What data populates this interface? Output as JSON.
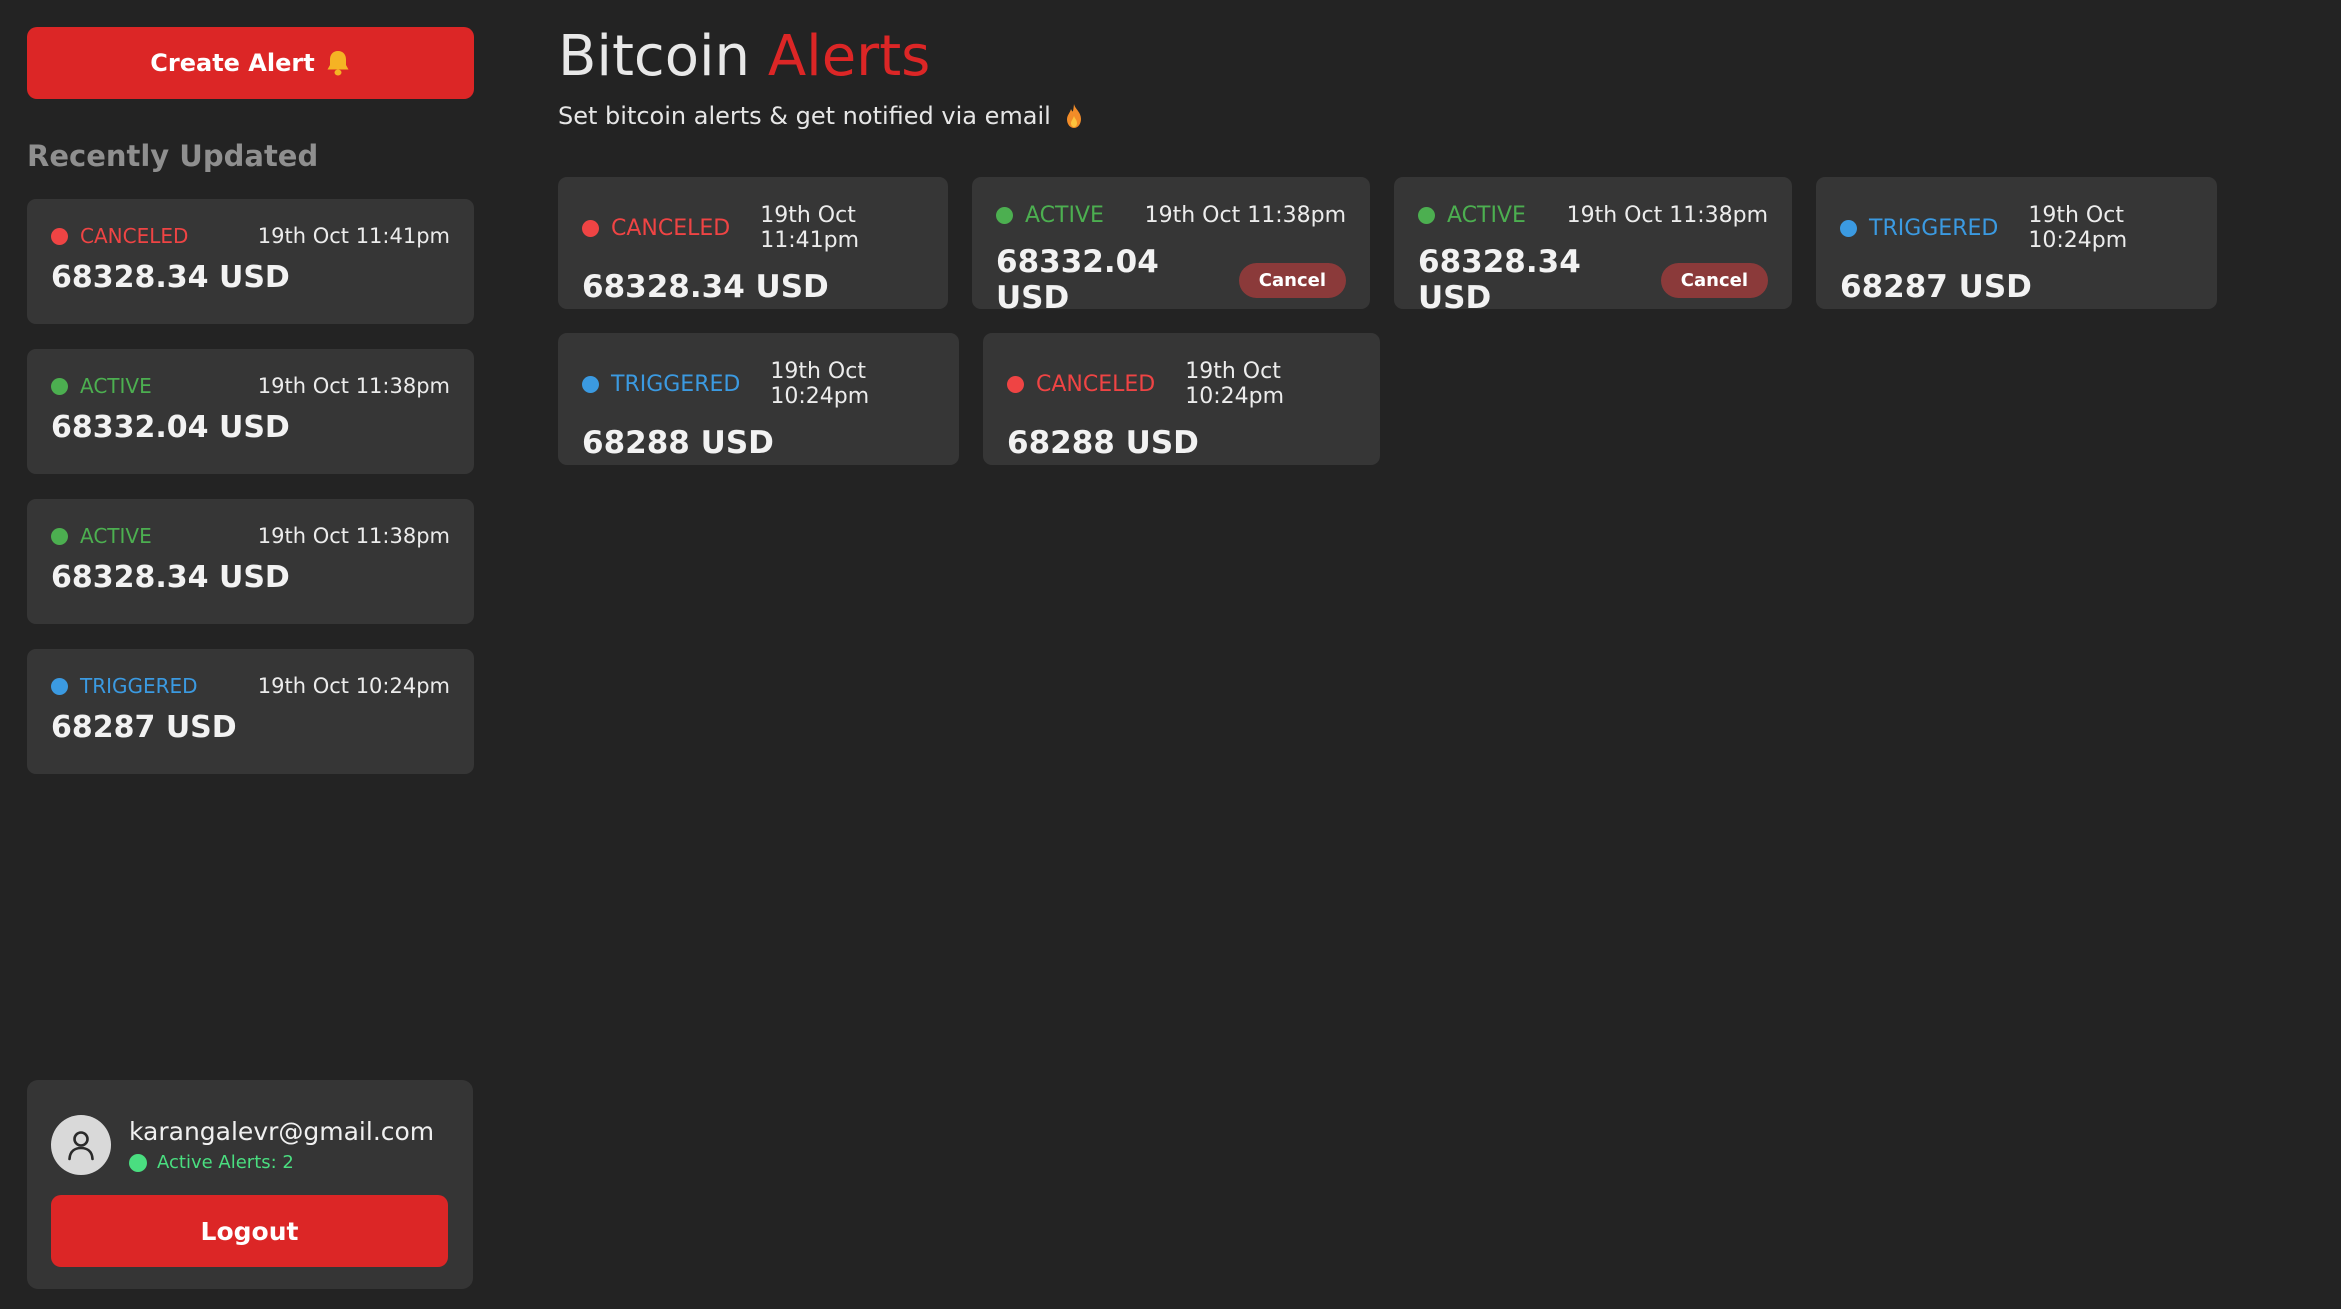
{
  "colors": {
    "background": "#232323",
    "card": "#363636",
    "accent": "#dc2626",
    "canceled": "#ef4444",
    "active": "#4caf50",
    "triggered": "#3b9ae1"
  },
  "sidebar": {
    "create_label": "Create Alert",
    "create_icon": "bell-icon",
    "recent_heading": "Recently Updated",
    "recent": [
      {
        "status": "CANCELED",
        "time": "19th Oct 11:41pm",
        "amount": "68328.34 USD"
      },
      {
        "status": "ACTIVE",
        "time": "19th Oct 11:38pm",
        "amount": "68332.04 USD"
      },
      {
        "status": "ACTIVE",
        "time": "19th Oct 11:38pm",
        "amount": "68328.34 USD"
      },
      {
        "status": "TRIGGERED",
        "time": "19th Oct 10:24pm",
        "amount": "68287 USD"
      }
    ],
    "user": {
      "avatar_icon": "user-icon",
      "email": "karangalevr@gmail.com",
      "active_alerts": "Active Alerts: 2",
      "logout_label": "Logout"
    }
  },
  "main": {
    "title_plain": "Bitcoin",
    "title_accent": "Alerts",
    "subtitle": "Set bitcoin alerts & get notified via email",
    "subtitle_icon": "flame-icon",
    "cancel_label": "Cancel",
    "alerts": [
      {
        "status": "CANCELED",
        "time": "19th Oct 11:41pm",
        "amount": "68328.34 USD"
      },
      {
        "status": "ACTIVE",
        "time": "19th Oct 11:38pm",
        "amount": "68332.04 USD"
      },
      {
        "status": "ACTIVE",
        "time": "19th Oct 11:38pm",
        "amount": "68328.34 USD"
      },
      {
        "status": "TRIGGERED",
        "time": "19th Oct 10:24pm",
        "amount": "68287 USD"
      },
      {
        "status": "TRIGGERED",
        "time": "19th Oct 10:24pm",
        "amount": "68288 USD"
      },
      {
        "status": "CANCELED",
        "time": "19th Oct 10:24pm",
        "amount": "68288 USD"
      }
    ]
  }
}
